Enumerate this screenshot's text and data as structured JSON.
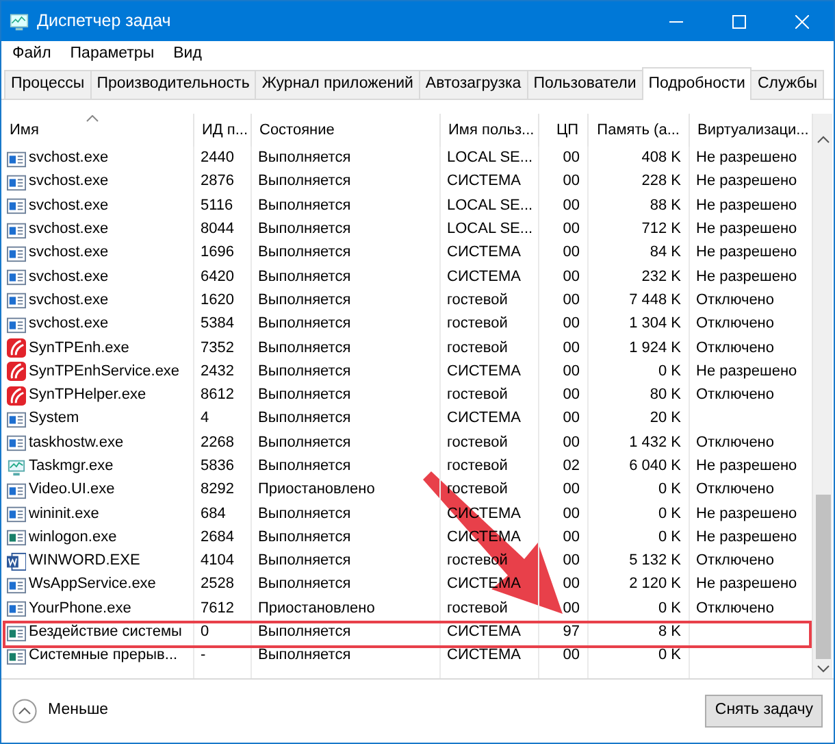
{
  "window": {
    "title": "Диспетчер задач"
  },
  "menu": [
    "Файл",
    "Параметры",
    "Вид"
  ],
  "tabs": [
    {
      "label": "Процессы",
      "selected": false
    },
    {
      "label": "Производительность",
      "selected": false
    },
    {
      "label": "Журнал приложений",
      "selected": false
    },
    {
      "label": "Автозагрузка",
      "selected": false
    },
    {
      "label": "Пользователи",
      "selected": false
    },
    {
      "label": "Подробности",
      "selected": true
    },
    {
      "label": "Службы",
      "selected": false
    }
  ],
  "table": {
    "columns": [
      {
        "label": "Имя",
        "sorted": true
      },
      {
        "label": "ИД п...",
        "sorted": false
      },
      {
        "label": "Состояние",
        "sorted": false
      },
      {
        "label": "Имя польз...",
        "sorted": false
      },
      {
        "label": "ЦП",
        "sorted": false
      },
      {
        "label": "Память (а...",
        "sorted": false
      },
      {
        "label": "Виртуализаци...",
        "sorted": false
      }
    ],
    "rows": [
      {
        "kind": "service",
        "cells": [
          "svchost.exe",
          "2440",
          "Выполняется",
          "LOCAL SE...",
          "00",
          "408 K",
          "Не разрешено"
        ],
        "highlighted": false
      },
      {
        "kind": "service",
        "cells": [
          "svchost.exe",
          "2876",
          "Выполняется",
          "СИСТЕМА",
          "00",
          "228 K",
          "Не разрешено"
        ],
        "highlighted": false
      },
      {
        "kind": "service",
        "cells": [
          "svchost.exe",
          "5116",
          "Выполняется",
          "LOCAL SE...",
          "00",
          "88 K",
          "Не разрешено"
        ],
        "highlighted": false
      },
      {
        "kind": "service",
        "cells": [
          "svchost.exe",
          "8044",
          "Выполняется",
          "LOCAL SE...",
          "00",
          "712 K",
          "Не разрешено"
        ],
        "highlighted": false
      },
      {
        "kind": "service",
        "cells": [
          "svchost.exe",
          "1696",
          "Выполняется",
          "СИСТЕМА",
          "00",
          "84 K",
          "Не разрешено"
        ],
        "highlighted": false
      },
      {
        "kind": "service",
        "cells": [
          "svchost.exe",
          "6420",
          "Выполняется",
          "СИСТЕМА",
          "00",
          "232 K",
          "Не разрешено"
        ],
        "highlighted": false
      },
      {
        "kind": "service",
        "cells": [
          "svchost.exe",
          "1620",
          "Выполняется",
          "гостевой",
          "00",
          "7 448 K",
          "Отключено"
        ],
        "highlighted": false
      },
      {
        "kind": "service",
        "cells": [
          "svchost.exe",
          "5384",
          "Выполняется",
          "гостевой",
          "00",
          "1 304 K",
          "Отключено"
        ],
        "highlighted": false
      },
      {
        "kind": "touchpad",
        "cells": [
          "SynTPEnh.exe",
          "7352",
          "Выполняется",
          "гостевой",
          "00",
          "1 924 K",
          "Отключено"
        ],
        "highlighted": false
      },
      {
        "kind": "touchpad",
        "cells": [
          "SynTPEnhService.exe",
          "2432",
          "Выполняется",
          "СИСТЕМА",
          "00",
          "0 K",
          "Не разрешено"
        ],
        "highlighted": false
      },
      {
        "kind": "touchpad",
        "cells": [
          "SynTPHelper.exe",
          "8612",
          "Выполняется",
          "гостевой",
          "00",
          "80 K",
          "Отключено"
        ],
        "highlighted": false
      },
      {
        "kind": "service",
        "cells": [
          "System",
          "4",
          "Выполняется",
          "СИСТЕМА",
          "00",
          "20 K",
          ""
        ],
        "highlighted": false
      },
      {
        "kind": "service",
        "cells": [
          "taskhostw.exe",
          "2268",
          "Выполняется",
          "гостевой",
          "00",
          "1 432 K",
          "Отключено"
        ],
        "highlighted": false
      },
      {
        "kind": "monitor",
        "cells": [
          "Taskmgr.exe",
          "5836",
          "Выполняется",
          "гостевой",
          "02",
          "6 040 K",
          "Не разрешено"
        ],
        "highlighted": false
      },
      {
        "kind": "service",
        "cells": [
          "Video.UI.exe",
          "8292",
          "Приостановлено",
          "гостевой",
          "00",
          "0 K",
          "Отключено"
        ],
        "highlighted": false
      },
      {
        "kind": "service",
        "cells": [
          "wininit.exe",
          "684",
          "Выполняется",
          "СИСТЕМА",
          "00",
          "0 K",
          "Не разрешено"
        ],
        "highlighted": false
      },
      {
        "kind": "system",
        "cells": [
          "winlogon.exe",
          "2684",
          "Выполняется",
          "СИСТЕМА",
          "00",
          "0 K",
          "Не разрешено"
        ],
        "highlighted": false
      },
      {
        "kind": "word",
        "cells": [
          "WINWORD.EXE",
          "4104",
          "Выполняется",
          "гостевой",
          "00",
          "5 132 K",
          "Отключено"
        ],
        "highlighted": false
      },
      {
        "kind": "service",
        "cells": [
          "WsAppService.exe",
          "2528",
          "Выполняется",
          "СИСТЕМА",
          "00",
          "2 120 K",
          "Не разрешено"
        ],
        "highlighted": false
      },
      {
        "kind": "service",
        "cells": [
          "YourPhone.exe",
          "7612",
          "Приостановлено",
          "гостевой",
          "00",
          "0 K",
          "Отключено"
        ],
        "highlighted": false
      },
      {
        "kind": "system",
        "cells": [
          "Бездействие системы",
          "0",
          "Выполняется",
          "СИСТЕМА",
          "97",
          "8 K",
          ""
        ],
        "highlighted": true
      },
      {
        "kind": "system",
        "cells": [
          "Системные прерыв...",
          "-",
          "Выполняется",
          "СИСТЕМА",
          "00",
          "0 K",
          ""
        ],
        "highlighted": false
      }
    ]
  },
  "footer": {
    "toggle": "Меньше",
    "button": "Снять задачу"
  }
}
